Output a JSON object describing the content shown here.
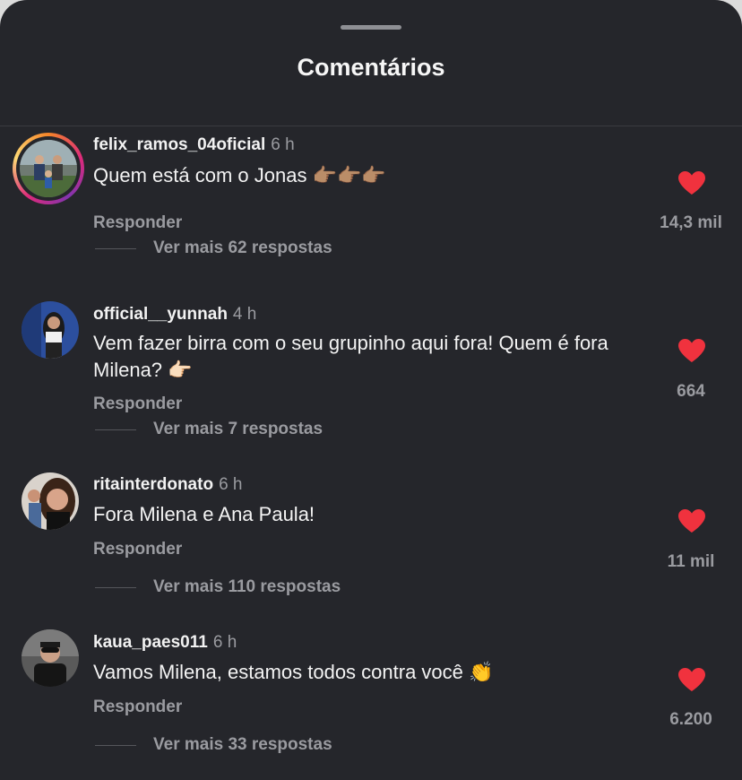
{
  "header": {
    "title": "Comentários"
  },
  "comments": [
    {
      "username": "felix_ramos_04oficial",
      "time": "6 h",
      "text": "Quem está com o Jonas 👉🏽👉🏽👉🏽",
      "reply_label": "Responder",
      "more_replies": "Ver mais 62 respostas",
      "likes": "14,3 mil",
      "has_story_ring": true,
      "avatar_icon": "family-photo-avatar"
    },
    {
      "username": "official__yunnah",
      "time": "4 h",
      "text": "Vem fazer birra com o seu grupinho aqui fora! Quem é fora Milena? 👉🏻",
      "reply_label": "Responder",
      "more_replies": "Ver mais 7 respostas",
      "likes": "664",
      "has_story_ring": false,
      "avatar_icon": "woman-photo-avatar"
    },
    {
      "username": "ritainterdonato",
      "time": "6 h",
      "text": "Fora Milena e Ana Paula!",
      "reply_label": "Responder",
      "more_replies": "Ver mais 110 respostas",
      "likes": "11 mil",
      "has_story_ring": false,
      "avatar_icon": "selfie-photo-avatar"
    },
    {
      "username": "kaua_paes011",
      "time": "6 h",
      "text": "Vamos Milena, estamos todos contra você 👏",
      "reply_label": "Responder",
      "more_replies": "Ver mais 33 respostas",
      "likes": "6.200",
      "has_story_ring": false,
      "avatar_icon": "man-photo-avatar"
    }
  ],
  "colors": {
    "background": "#25262b",
    "heart": "#f0323e",
    "muted_text": "#9a9ba0",
    "primary_text": "#f3f3f3"
  },
  "icons": {
    "like": "heart-icon",
    "grabber": "drag-handle-icon"
  }
}
